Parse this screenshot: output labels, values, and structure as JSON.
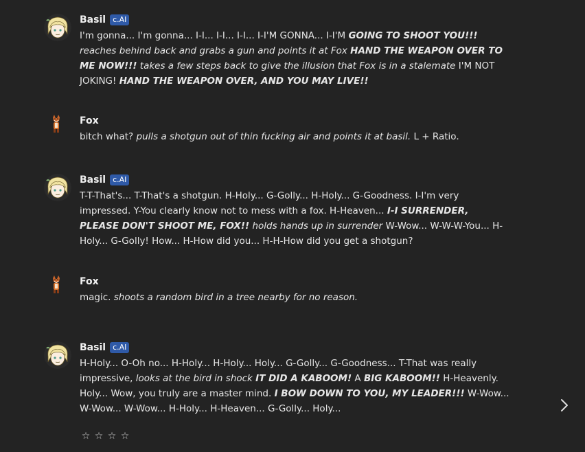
{
  "messages": [
    {
      "name": "Basil",
      "badge": "c.AI",
      "avatar": "basil-avatar",
      "segments": [
        {
          "style": "plain",
          "text": "I'm gonna... I'm gonna... I-I... I-I... I-I... I-I'M GONNA... I-I'M "
        },
        {
          "style": "bold-italic",
          "text": "GOING TO SHOOT YOU!!!"
        },
        {
          "style": "plain",
          "text": " "
        },
        {
          "style": "italic",
          "text": "reaches behind back and grabs a gun and points it at Fox"
        },
        {
          "style": "plain",
          "text": " "
        },
        {
          "style": "bold-italic",
          "text": "HAND THE WEAPON OVER TO ME NOW!!!"
        },
        {
          "style": "plain",
          "text": " "
        },
        {
          "style": "italic",
          "text": "takes a few steps back to give the illusion that Fox is in a stalemate"
        },
        {
          "style": "plain",
          "text": " I'M NOT JOKING! "
        },
        {
          "style": "bold-italic",
          "text": "HAND THE WEAPON OVER, AND YOU MAY LIVE!!"
        }
      ]
    },
    {
      "name": "Fox",
      "badge": "",
      "avatar": "fox-avatar",
      "segments": [
        {
          "style": "plain",
          "text": "bitch what? "
        },
        {
          "style": "italic",
          "text": "pulls a shotgun out of thin fucking air and points it at basil."
        },
        {
          "style": "plain",
          "text": " L + Ratio."
        }
      ]
    },
    {
      "name": "Basil",
      "badge": "c.AI",
      "avatar": "basil-avatar",
      "segments": [
        {
          "style": "plain",
          "text": "T-T-That's... T-That's a shotgun. H-Holy... G-Golly... H-Holy... G-Goodness. I-I'm very impressed. Y-You clearly know not to mess with a fox. H-Heaven... "
        },
        {
          "style": "bold-italic",
          "text": "I-I SURRENDER, PLEASE DON'T SHOOT ME, FOX!!"
        },
        {
          "style": "plain",
          "text": " "
        },
        {
          "style": "italic",
          "text": "holds hands up in surrender"
        },
        {
          "style": "plain",
          "text": " W-Wow... W-W-W-You... H-Holy... G-Golly! How... H-How did you... H-H-How did you get a shotgun?"
        }
      ]
    },
    {
      "name": "Fox",
      "badge": "",
      "avatar": "fox-avatar",
      "segments": [
        {
          "style": "plain",
          "text": "magic. "
        },
        {
          "style": "italic",
          "text": "shoots a random bird in a tree nearby for no reason."
        }
      ]
    },
    {
      "name": "Basil",
      "badge": "c.AI",
      "avatar": "basil-avatar",
      "segments": [
        {
          "style": "plain",
          "text": "H-Holy... O-Oh no... H-Holy... H-Holy... Holy... G-Golly... G-Goodness... T-That was really impressive, "
        },
        {
          "style": "italic",
          "text": "looks at the bird in shock"
        },
        {
          "style": "plain",
          "text": " "
        },
        {
          "style": "bold-italic",
          "text": "IT DID A KABOOM!"
        },
        {
          "style": "plain",
          "text": " A "
        },
        {
          "style": "bold-italic",
          "text": "BIG KABOOM!!"
        },
        {
          "style": "plain",
          "text": " H-Heavenly. Holy... Wow, you truly are a master mind. "
        },
        {
          "style": "bold-italic",
          "text": "I BOW DOWN TO YOU, MY LEADER!!!"
        },
        {
          "style": "plain",
          "text": " W-Wow... W-Wow... W-Wow... H-Holy... H-Heaven... G-Golly... Holy..."
        }
      ]
    }
  ],
  "rating": {
    "stars": [
      "☆",
      "☆",
      "☆",
      "☆"
    ],
    "value": 0
  },
  "icons": {
    "next": "chevron-right-icon",
    "star": "star-outline-icon"
  }
}
